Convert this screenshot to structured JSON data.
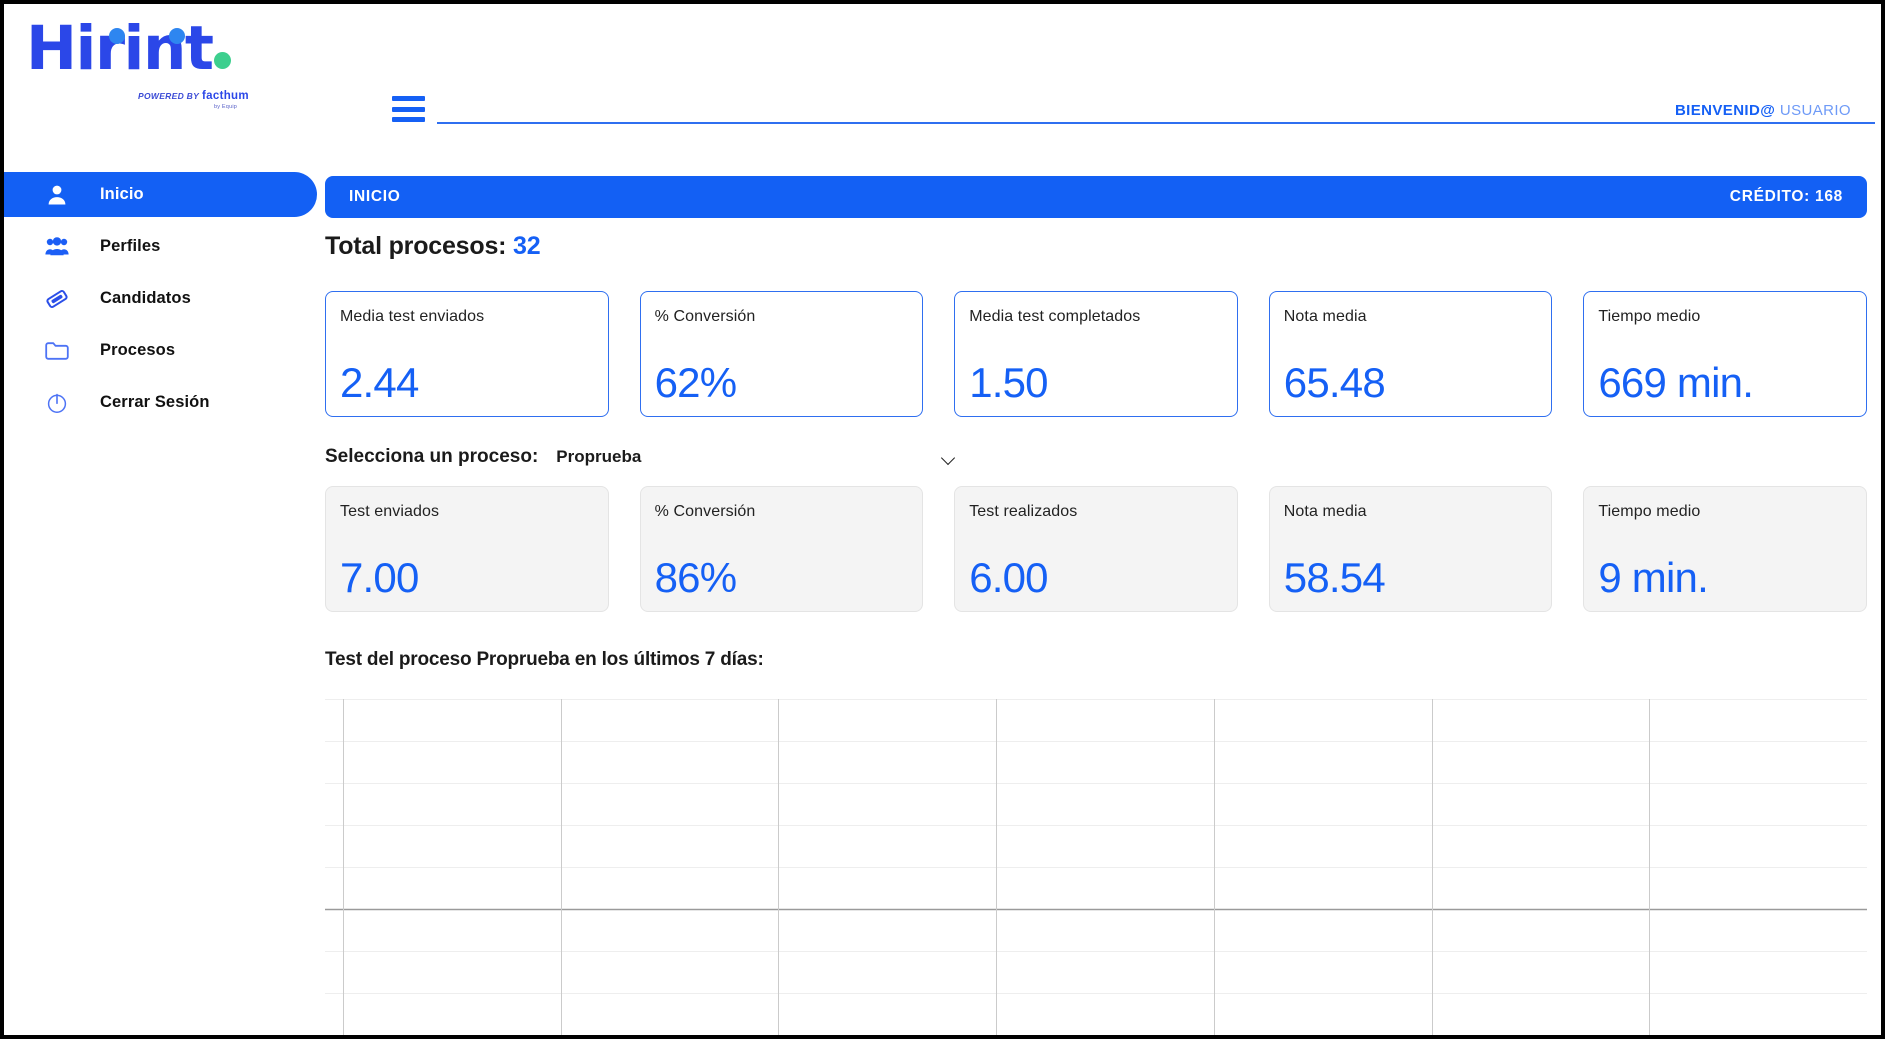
{
  "brand": {
    "name": "Hirint",
    "powered_by_prefix": "POWERED BY",
    "powered_by_name": "facthum",
    "powered_by_tagline": "by Equip"
  },
  "sidebar": {
    "items": [
      {
        "label": "Inicio",
        "icon": "user-icon",
        "active": true
      },
      {
        "label": "Perfiles",
        "icon": "users-icon",
        "active": false
      },
      {
        "label": "Candidatos",
        "icon": "tag-icon",
        "active": false
      },
      {
        "label": "Procesos",
        "icon": "folder-icon",
        "active": false
      },
      {
        "label": "Cerrar Sesión",
        "icon": "power-icon",
        "active": false
      }
    ]
  },
  "header": {
    "menu_icon": "hamburger-icon",
    "welcome_bold": "BIENVENID@",
    "welcome_light": "USUARIO"
  },
  "page_bar": {
    "title": "INICIO",
    "credit": "CRÉDITO: 168"
  },
  "totals": {
    "label": "Total procesos:",
    "value": "32"
  },
  "global_cards": [
    {
      "label": "Media test enviados",
      "value": "2.44"
    },
    {
      "label": "% Conversión",
      "value": "62%"
    },
    {
      "label": "Media test completados",
      "value": "1.50"
    },
    {
      "label": "Nota media",
      "value": "65.48"
    },
    {
      "label": "Tiempo medio",
      "value": "669 min."
    }
  ],
  "selector": {
    "label": "Selecciona un proceso:",
    "selected": "Proprueba",
    "chevron_icon": "chevron-down-icon"
  },
  "process_cards": [
    {
      "label": "Test enviados",
      "value": "7.00"
    },
    {
      "label": "% Conversión",
      "value": "86%"
    },
    {
      "label": "Test realizados",
      "value": "6.00"
    },
    {
      "label": "Nota media",
      "value": "58.54"
    },
    {
      "label": "Tiempo medio",
      "value": "9 min."
    }
  ],
  "chart_section": {
    "title": "Test del proceso Proprueba en los últimos 7 días:"
  },
  "chart_data": {
    "type": "bar",
    "title": "Test del proceso Proprueba en los últimos 7 días:",
    "categories": [
      "",
      "",
      "",
      "",
      "",
      "",
      ""
    ],
    "values": [
      0,
      0,
      0,
      0,
      0,
      0,
      0
    ],
    "series": [
      {
        "name": "",
        "values": [
          0,
          0,
          0,
          0,
          0,
          0,
          0
        ]
      }
    ],
    "xlabel": "",
    "ylabel": "",
    "ylim": [
      0,
      8
    ],
    "grid": true,
    "legend": "none",
    "notes": "Empty plot area: gridlines only, no bars, axis tick labels not rendered",
    "gridlines_vertical": 7,
    "gridlines_horizontal": 8,
    "baseline_row_index": 5,
    "colors": {
      "grid": "#eeeeee",
      "grid_strong": "#cbcbcb",
      "baseline": "#9a9a9a"
    }
  },
  "colors": {
    "brand_blue": "#2b47e8",
    "accent_blue": "#1560f5",
    "bar_blue": "#1360f4",
    "green_dot": "#3dcf8e",
    "card_muted_bg": "#f4f4f4",
    "text_dark": "#1b1b1b"
  }
}
